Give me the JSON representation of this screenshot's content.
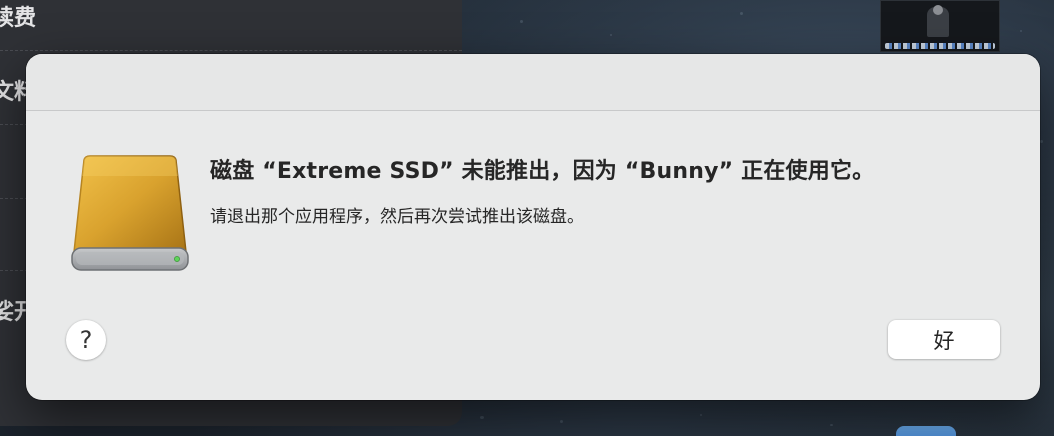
{
  "background_window": {
    "rows": [
      "续费",
      "文料",
      "娑开"
    ]
  },
  "alert": {
    "title": "磁盘 “Extreme SSD” 未能推出，因为 “Bunny” 正在使用它。",
    "message": "请退出那个应用程序，然后再次尝试推出该磁盘。",
    "help_label": "?",
    "ok_label": "好",
    "icon": "external-disk-icon"
  },
  "colors": {
    "dialog_bg": "#e9eaea",
    "disk_gold": "#d9a22e",
    "disk_led": "#5fd35a"
  }
}
